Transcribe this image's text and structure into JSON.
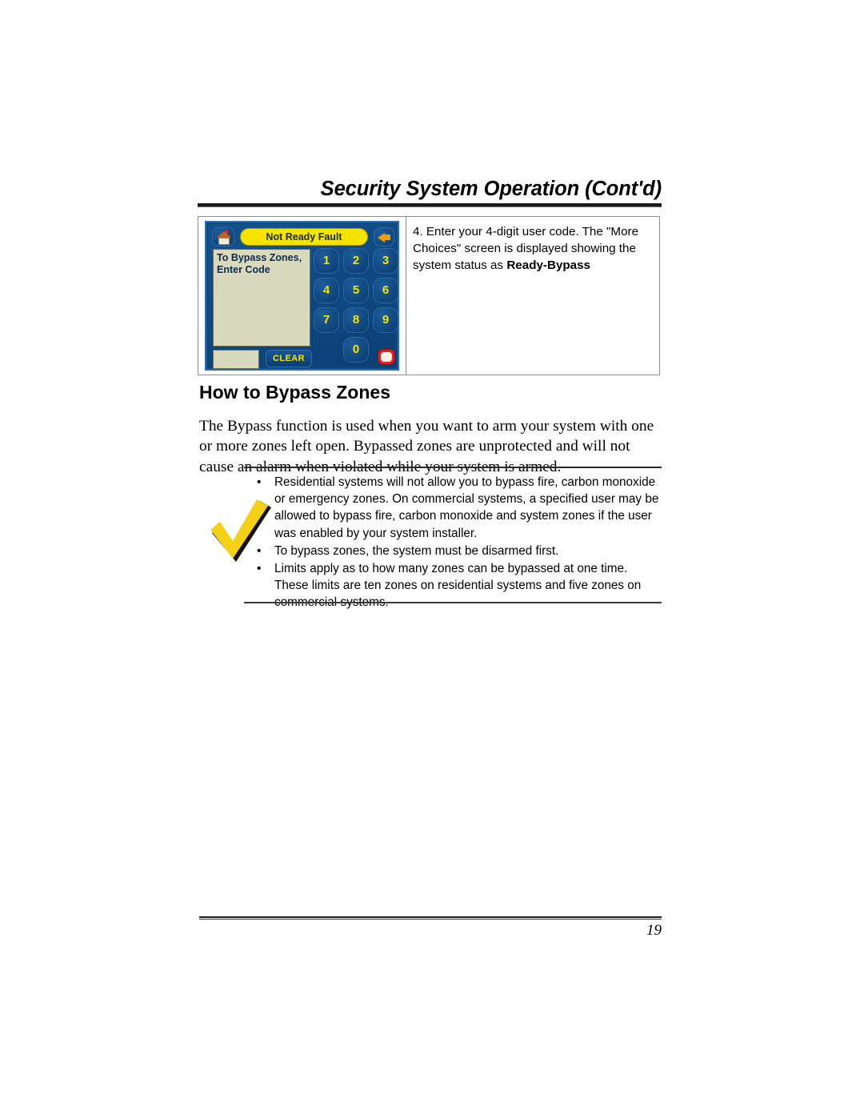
{
  "header": {
    "title": "Security System Operation (Cont'd)"
  },
  "step_table": {
    "keypad": {
      "home_icon": "home-icon",
      "banner_text": "Not Ready Fault",
      "back_icon": "back-arrow-icon",
      "display_text": "To Bypass Zones, Enter Code",
      "entry_field_value": "",
      "clear_label": "CLEAR",
      "keys": [
        "1",
        "2",
        "3",
        "4",
        "5",
        "6",
        "7",
        "8",
        "9",
        "0"
      ],
      "panic_icon": "panic-badge-icon",
      "colors": {
        "panel_background": "#0e4a87",
        "banner": "#f5e400",
        "key_text": "#f5e400",
        "display_background": "#d9d9bd",
        "display_text": "#11294d"
      }
    },
    "step": {
      "number": "4.",
      "text_part1": "Enter your 4-digit user code.  The \"More Choices\" screen is displayed showing the system status as ",
      "text_bold": "Ready-Bypass"
    }
  },
  "section": {
    "heading": "How to Bypass Zones",
    "paragraph": "The Bypass function is used when you want to arm your system with one or more zones left open. Bypassed zones are unprotected and will not cause an alarm when violated while your system is armed."
  },
  "note": {
    "icon": "checkmark-icon",
    "bullet_char": "•",
    "items": [
      "Residential systems will not allow you to bypass fire, carbon monoxide or emergency zones. On commercial systems, a specified user may be allowed to bypass fire, carbon monoxide and system zones if the user was enabled by your system installer.",
      "To bypass zones, the system must be disarmed first.",
      "Limits apply as to how many zones can be bypassed at one time. These limits are ten zones on residential systems and five zones on commercial systems."
    ]
  },
  "footer": {
    "page_number": "19"
  }
}
